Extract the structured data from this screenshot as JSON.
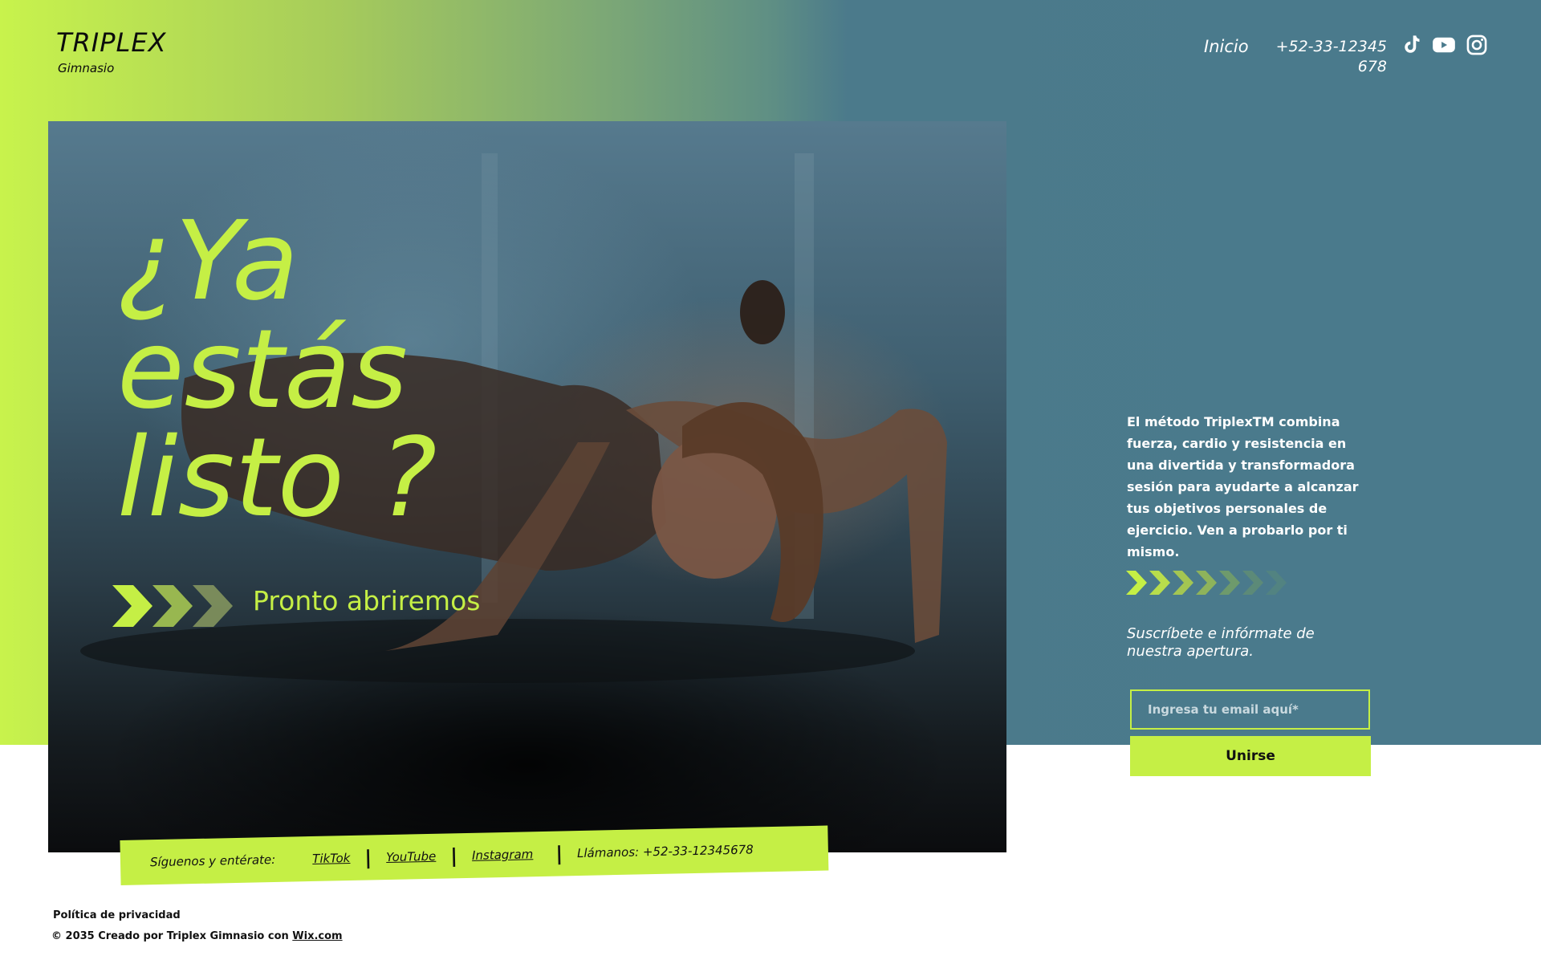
{
  "brand": {
    "title": "TRIPLEX",
    "subtitle": "Gimnasio"
  },
  "nav": {
    "home": "Inicio",
    "phone": "+52-33-12345678"
  },
  "social_icons": [
    "tiktok-icon",
    "youtube-icon",
    "instagram-icon"
  ],
  "hero": {
    "title_lines": [
      "¿Ya",
      "estás",
      "listo ?"
    ],
    "coming_soon": "Pronto abriremos"
  },
  "ribbon": {
    "follow_label": "Síguenos y entérate:",
    "tiktok": "TikTok",
    "youtube": "YouTube",
    "instagram": "Instagram",
    "call": "Llámanos: +52-33-12345678"
  },
  "side": {
    "description": "El método TriplexTM combina fuerza, cardio y resistencia en una divertida y transformadora sesión para ayudarte a alcanzar tus objetivos personales de ejercicio. Ven a probarlo por ti mismo.",
    "subscribe_text": "Suscríbete e infórmate de nuestra apertura.",
    "email_placeholder": "Ingresa tu email aquí*",
    "email_value": "",
    "join_label": "Unirse"
  },
  "footer": {
    "privacy": "Política de privacidad",
    "copyright_prefix": "© 2035 Creado por Triplex Gimnasio con ",
    "wix": "Wix.com"
  },
  "colors": {
    "accent": "#c5ef45",
    "teal": "#4a7a8c",
    "text_dark": "#111111"
  }
}
